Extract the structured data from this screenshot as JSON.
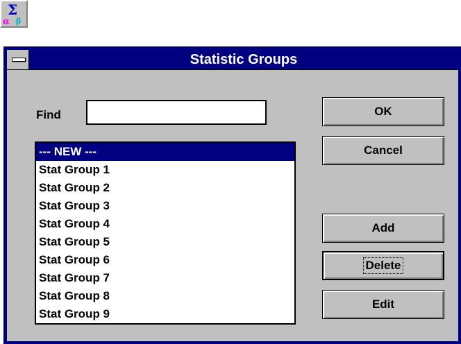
{
  "app_icon": {
    "icon": "sigma-alpha-beta-icon"
  },
  "dialog": {
    "title": "Statistic Groups",
    "system_menu_icon": "system-menu-icon"
  },
  "find": {
    "label": "Find",
    "value": ""
  },
  "list": {
    "items": [
      {
        "label": "--- NEW ---",
        "selected": true
      },
      {
        "label": "Stat Group 1"
      },
      {
        "label": "Stat Group 2"
      },
      {
        "label": "Stat Group 3"
      },
      {
        "label": "Stat Group 4"
      },
      {
        "label": "Stat Group 5"
      },
      {
        "label": "Stat Group 6"
      },
      {
        "label": "Stat Group 7"
      },
      {
        "label": "Stat Group 8"
      },
      {
        "label": "Stat Group 9"
      }
    ]
  },
  "buttons": {
    "ok": "OK",
    "cancel": "Cancel",
    "add": "Add",
    "delete": "Delete",
    "edit": "Edit"
  },
  "colors": {
    "title_bar": "#000080",
    "face": "#c0c0c0",
    "selection": "#000080"
  }
}
